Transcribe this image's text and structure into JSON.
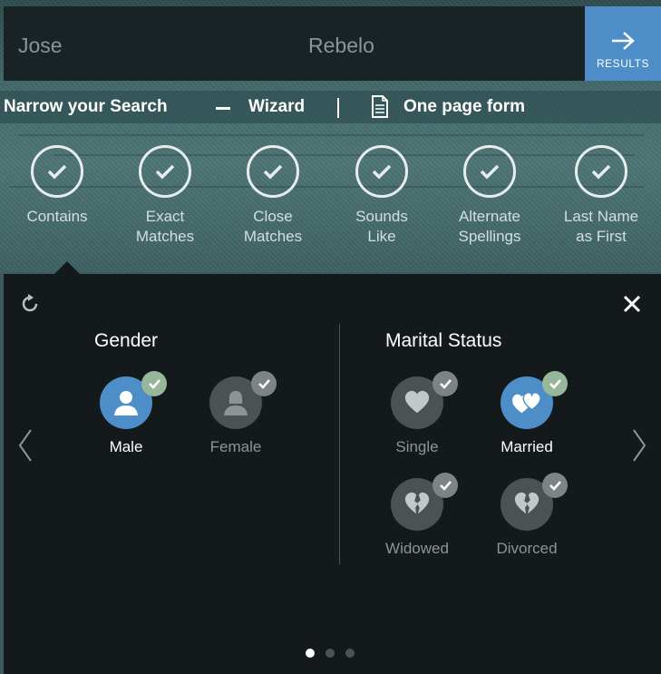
{
  "search": {
    "first_name": "Jose",
    "last_name": "Rebelo",
    "results_label": "RESULTS"
  },
  "narrow": {
    "title": "Narrow your Search",
    "wizard_label": "Wizard",
    "one_page_label": "One page form"
  },
  "match_options": [
    {
      "label": "Contains",
      "checked": true
    },
    {
      "label": "Exact\nMatches",
      "checked": true
    },
    {
      "label": "Close\nMatches",
      "checked": true
    },
    {
      "label": "Sounds\nLike",
      "checked": true
    },
    {
      "label": "Alternate\nSpellings",
      "checked": true
    },
    {
      "label": "Last Name\nas First",
      "checked": true
    }
  ],
  "gender": {
    "title": "Gender",
    "options": [
      {
        "label": "Male",
        "selected": true,
        "icon": "person-icon"
      },
      {
        "label": "Female",
        "selected": false,
        "icon": "person-female-icon"
      }
    ]
  },
  "marital_status": {
    "title": "Marital Status",
    "options": [
      {
        "label": "Single",
        "selected": false,
        "icon": "heart-icon"
      },
      {
        "label": "Married",
        "selected": true,
        "icon": "two-hearts-icon"
      },
      {
        "label": "Widowed",
        "selected": false,
        "icon": "broken-heart-icon"
      },
      {
        "label": "Divorced",
        "selected": false,
        "icon": "broken-heart-icon"
      }
    ]
  },
  "pagination": {
    "current": 1,
    "total": 3
  },
  "colors": {
    "accent": "#4d8ec8",
    "badge_selected": "#97b79b",
    "panel": "#141a1b"
  }
}
